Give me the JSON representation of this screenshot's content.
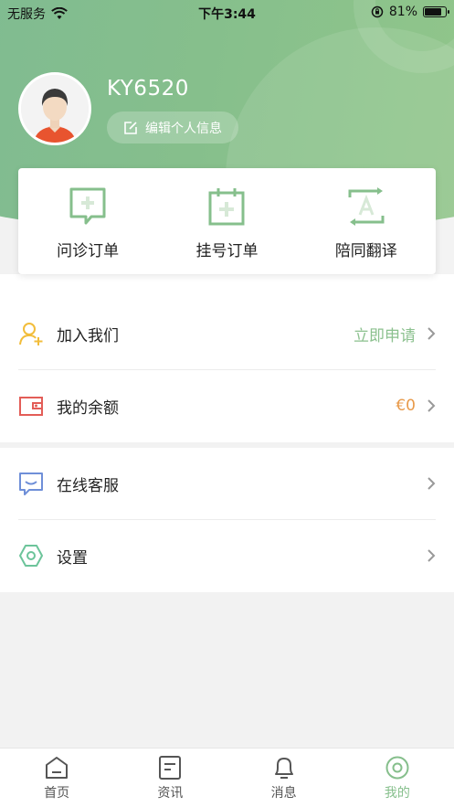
{
  "status_bar": {
    "carrier": "无服务",
    "time": "下午3:44",
    "battery": "81%",
    "battery_level": 0.81
  },
  "profile": {
    "username": "KY6520",
    "edit_label": "编辑个人信息"
  },
  "services": [
    {
      "label": "问诊订单",
      "icon": "consult-order-icon"
    },
    {
      "label": "挂号订单",
      "icon": "registration-order-icon"
    },
    {
      "label": "陪同翻译",
      "icon": "translation-icon"
    }
  ],
  "menu": {
    "join": {
      "label": "加入我们",
      "value": "立即申请",
      "icon": "user-add-icon"
    },
    "balance": {
      "label": "我的余额",
      "value": "€0",
      "icon": "wallet-icon"
    },
    "service": {
      "label": "在线客服",
      "icon": "chat-icon"
    },
    "settings": {
      "label": "设置",
      "icon": "settings-icon"
    }
  },
  "tabs": [
    {
      "label": "首页",
      "icon": "home-icon"
    },
    {
      "label": "资讯",
      "icon": "news-icon"
    },
    {
      "label": "消息",
      "icon": "bell-icon"
    },
    {
      "label": "我的",
      "icon": "profile-icon",
      "active": true
    }
  ],
  "colors": {
    "brand_green": "#86bf8c",
    "join_value": "#8cc18f",
    "balance_value": "#e89a4a",
    "chevron": "#999999"
  }
}
